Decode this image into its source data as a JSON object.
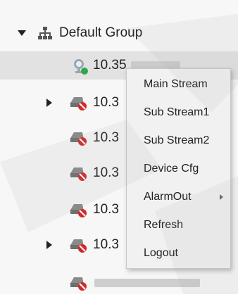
{
  "tree": {
    "group": {
      "label": "Default Group"
    },
    "devices": [
      {
        "ip": "10.35",
        "status": "online"
      },
      {
        "ip": "10.3",
        "status": "offline"
      },
      {
        "ip": "10.3",
        "status": "offline"
      },
      {
        "ip": "10.3",
        "status": "offline"
      },
      {
        "ip": "10.3",
        "status": "offline"
      },
      {
        "ip": "10.3",
        "status": "offline"
      },
      {
        "ip": "",
        "status": "offline"
      }
    ]
  },
  "context_menu": {
    "items": [
      {
        "label": "Main Stream"
      },
      {
        "label": "Sub Stream1"
      },
      {
        "label": "Sub Stream2"
      },
      {
        "label": "Device Cfg"
      },
      {
        "label": "AlarmOut",
        "submenu": true
      },
      {
        "label": "Refresh"
      },
      {
        "label": "Logout"
      }
    ]
  },
  "colors": {
    "online": "#2ea84a",
    "offline": "#d12a2a",
    "device_grey": "#8a8a8a",
    "highlight": "#e2e2e2"
  }
}
